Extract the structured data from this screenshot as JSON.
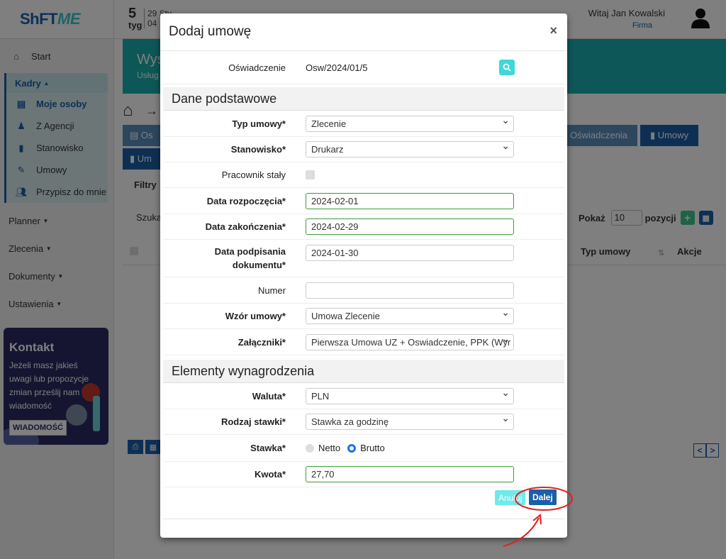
{
  "app": {
    "logo_part1": "ShFT",
    "logo_part2": "ME",
    "week_number": "5",
    "week_label": "tyg",
    "date_line1": "29 Sty",
    "date_line2": "04",
    "greeting": "Witaj Jan Kowalski",
    "company": "Firma"
  },
  "sidebar": {
    "start": "Start",
    "kadry": "Kadry",
    "kadry_items": [
      {
        "label": "Moje osoby",
        "icon": "id-card-icon"
      },
      {
        "label": "Z Agencji",
        "icon": "user-edit-icon"
      },
      {
        "label": "Stanowisko",
        "icon": "book-icon"
      },
      {
        "label": "Umowy",
        "icon": "contract-icon"
      },
      {
        "label": "Przypisz do mnie",
        "icon": "users-icon"
      }
    ],
    "planner": "Planner",
    "zlecenia": "Zlecenia",
    "dokumenty": "Dokumenty",
    "ustawienia": "Ustawienia"
  },
  "contact": {
    "title": "Kontakt",
    "text": "Jeżeli masz jakieś uwagi lub propozycje zmian prześlij nam wiadomość",
    "button": "WIADOMOŚĆ"
  },
  "background": {
    "banner_title": "Wyś",
    "banner_sub": "Usług",
    "tab_oswiadczenia": "Oświadczenia",
    "tab_umowy": "Umowy",
    "tab_os": "Os",
    "tab_um": "Um",
    "filtry": "Filtry",
    "szukaj": "Szuka",
    "pokaz": "Pokaż",
    "pokaz_value": "10",
    "pozycji": "pozycji",
    "col_typ": "Typ umowy",
    "col_akcje": "Akcje"
  },
  "modal": {
    "title": "Dodaj umowę",
    "oswiadczenie_label": "Oświadczenie",
    "oswiadczenie_value": "Osw/2024/01/5",
    "section1": "Dane podstawowe",
    "typ_label": "Typ umowy*",
    "typ_value": "Zlecenie",
    "stanowisko_label": "Stanowisko*",
    "stanowisko_value": "Drukarz",
    "pracownik_label": "Pracownik stały",
    "data_rozp_label": "Data rozpoczęcia*",
    "data_rozp_value": "2024-02-01",
    "data_zak_label": "Data zakończenia*",
    "data_zak_value": "2024-02-29",
    "data_podp_label1": "Data podpisania",
    "data_podp_label2": "dokumentu*",
    "data_podp_value": "2024-01-30",
    "numer_label": "Numer",
    "numer_value": "",
    "wzor_label": "Wzór umowy*",
    "wzor_value": "Umowa Zlecenie",
    "zalaczniki_label": "Załączniki*",
    "zalaczniki_value": "Pierwsza Umowa UZ + Oswiadczenie, PPK (Wyr",
    "section2": "Elementy wynagrodzenia",
    "waluta_label": "Waluta*",
    "waluta_value": "PLN",
    "rodzaj_label": "Rodzaj stawki*",
    "rodzaj_value": "Stawka za godzinę",
    "stawka_label": "Stawka*",
    "netto": "Netto",
    "brutto": "Brutto",
    "kwota_label": "Kwota*",
    "kwota_value": "27,70",
    "anuluj": "Anuluj",
    "dalej": "Dalej"
  },
  "colors": {
    "primary": "#1a5fa8",
    "teal": "#1aaeb0",
    "annotation": "#e02020"
  }
}
